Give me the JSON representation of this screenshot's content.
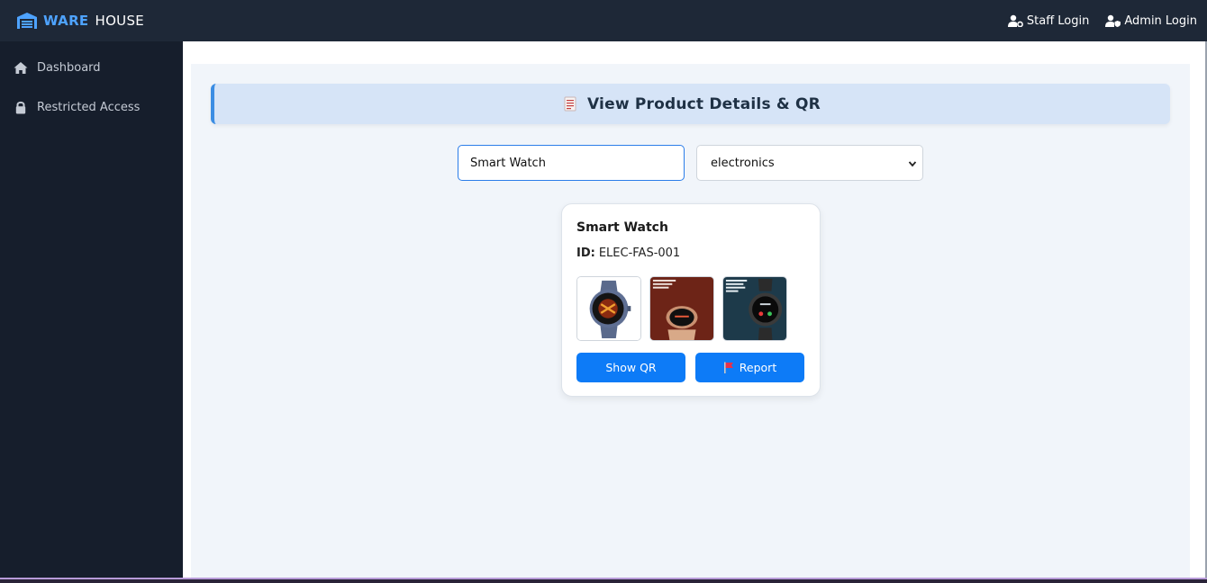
{
  "brand": {
    "ware": "WARE",
    "house": "HOUSE",
    "icon": "warehouse-icon"
  },
  "topnav": [
    {
      "label": "Staff Login",
      "icon": "user-gear-icon"
    },
    {
      "label": "Admin Login",
      "icon": "user-shield-icon"
    }
  ],
  "sidebar": {
    "items": [
      {
        "label": "Dashboard",
        "icon": "home-icon"
      },
      {
        "label": "Restricted Access",
        "icon": "lock-icon"
      }
    ]
  },
  "page": {
    "title": "View Product Details & QR",
    "title_icon": "document-icon"
  },
  "search": {
    "value": "Smart Watch",
    "placeholder": ""
  },
  "category": {
    "selected": "electronics"
  },
  "product": {
    "name": "Smart Watch",
    "id_label": "ID:",
    "id_value": "ELEC-FAS-001",
    "thumbnail_icons": [
      "watch-image-1",
      "watch-image-2",
      "watch-image-3"
    ],
    "show_qr_label": "Show QR",
    "report_label": "Report",
    "report_icon": "flag-icon"
  },
  "colors": {
    "topbar": "#1e2837",
    "sidebar": "#161e2c",
    "accent": "#0d7bf7",
    "brand": "#4ea3ff",
    "header_bg": "#d6e4f7"
  }
}
